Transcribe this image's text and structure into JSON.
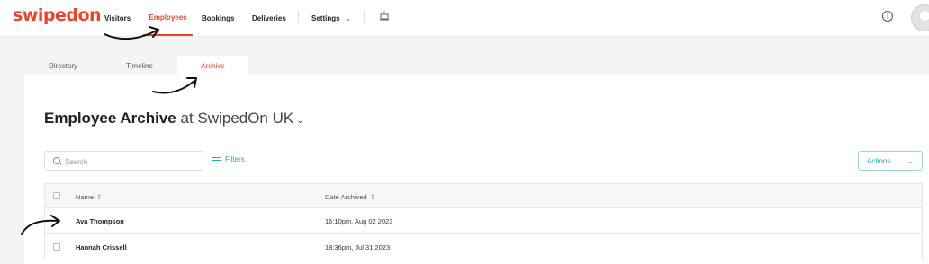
{
  "brand": {
    "logo_text": "swipedon",
    "accent": "#e8462b",
    "link_color": "#2ba3c2"
  },
  "nav": {
    "items": [
      {
        "label": "Visitors",
        "active": false
      },
      {
        "label": "Employees",
        "active": true
      },
      {
        "label": "Bookings",
        "active": false
      },
      {
        "label": "Deliveries",
        "active": false
      },
      {
        "label": "Settings",
        "active": false
      }
    ],
    "icons": [
      "notification-icon",
      "info-icon",
      "user-avatar"
    ]
  },
  "subtabs": [
    {
      "label": "Directory",
      "active": false
    },
    {
      "label": "Timeline",
      "active": false
    },
    {
      "label": "Archive",
      "active": true
    }
  ],
  "page": {
    "title_strong": "Employee Archive",
    "title_at": "at",
    "location": "SwipedOn UK"
  },
  "search": {
    "placeholder": "Search",
    "value": ""
  },
  "filters_label": "Filters",
  "actions_label": "Actions",
  "table": {
    "columns": [
      "Name",
      "Date Archived"
    ],
    "rows": [
      {
        "name": "Ava Thompson",
        "date_archived": "16:10pm, Aug 02 2023"
      },
      {
        "name": "Hannah Crissell",
        "date_archived": "18:36pm, Jul 31 2023"
      }
    ]
  }
}
